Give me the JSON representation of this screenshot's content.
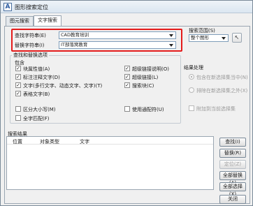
{
  "window": {
    "title": "图形搜索定位",
    "app_icon_glyph": "A"
  },
  "tabs": [
    {
      "label": "图元搜索",
      "active": false
    },
    {
      "label": "文字搜索",
      "active": true
    }
  ],
  "find": {
    "label": "查找字符串(E)",
    "value": "CAD教育培训"
  },
  "replace": {
    "label": "替换字符串(I)",
    "value": "IT部落窝教育"
  },
  "search_scope": {
    "label": "搜索范围(S)",
    "value": "整个图形"
  },
  "options": {
    "title": "查找和替换选项",
    "include_label": "包含",
    "items": [
      {
        "label": "块属性值(A)",
        "checked": true
      },
      {
        "label": "标注注释文字(D)",
        "checked": true
      },
      {
        "label": "文字(多行文字、动态文字、文字)(T)",
        "checked": true
      },
      {
        "label": "表格文字(B)",
        "checked": true
      },
      {
        "label": "超级链接说明(O)",
        "checked": true
      },
      {
        "label": "超级链接(L)",
        "checked": true
      },
      {
        "label": "搜索块(C)",
        "checked": true
      },
      {
        "label": "区分大小写(M)",
        "checked": false
      },
      {
        "label": "全字匹配(F)",
        "checked": false
      },
      {
        "label": "使用通配符(U)",
        "checked": false
      }
    ],
    "check_glyph": "✓"
  },
  "result_process": {
    "title": "结果处理",
    "radio1": "包含在新选择集当中(N)",
    "radio2": "排除在新选择集之外(X)",
    "check": "附加到当前选择集"
  },
  "results": {
    "title": "搜索结果",
    "columns": [
      "位置",
      "对象类型",
      "文字"
    ]
  },
  "buttons": {
    "find": "查找(I)",
    "replace": "替换(R)",
    "locate": "定位(Z)",
    "replace_all": "全部替换(A)",
    "select_all": "全部选择(X)",
    "close": "关闭"
  }
}
